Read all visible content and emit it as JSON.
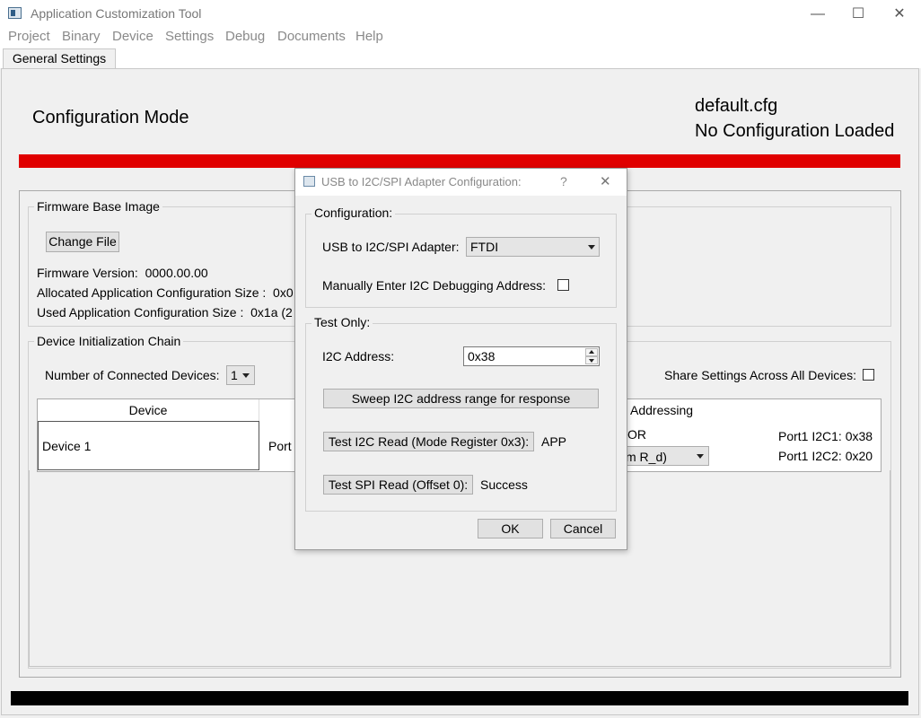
{
  "window": {
    "title": "Application Customization Tool",
    "minimize_glyph": "—",
    "maximize_glyph": "☐",
    "close_glyph": "✕"
  },
  "menu": [
    "Project",
    "Binary",
    "Device",
    "Settings",
    "Debug",
    "Documents",
    "Help"
  ],
  "tabs": [
    {
      "label": "General Settings"
    }
  ],
  "header": {
    "mode_title": "Configuration Mode",
    "config_file": "default.cfg",
    "config_status": "No Configuration Loaded"
  },
  "firmware": {
    "group_title": "Firmware Base Image",
    "change_file_label": "Change File",
    "version_line": "Firmware Version:  0000.00.00",
    "allocated_line": "Allocated Application Configuration Size :  0x0",
    "used_line": "Used Application Configuration Size :  0x1a (2"
  },
  "chain": {
    "group_title": "Device Initialization Chain",
    "num_devices_label": "Number of Connected Devices:",
    "num_devices_value": "1",
    "share_label": "Share Settings Across All Devices:",
    "table": {
      "col_device": "Device",
      "col_addressing": "Addressing",
      "rows": [
        {
          "device": "Device 1",
          "port_partial": "Port",
          "or_fragment": "OR",
          "select_fragment": "m R_d)",
          "port1_i2c1": "Port1 I2C1: 0x38",
          "port1_i2c2": "Port1 I2C2: 0x20"
        }
      ]
    }
  },
  "dialog": {
    "title": "USB to I2C/SPI Adapter Configuration:",
    "help_glyph": "?",
    "close_glyph": "✕",
    "config_group": "Configuration:",
    "adapter_label": "USB to I2C/SPI Adapter:",
    "adapter_value": "FTDI",
    "manual_label": "Manually Enter I2C Debugging Address:",
    "test_group": "Test Only:",
    "i2c_address_label": "I2C Address:",
    "i2c_address_value": "0x38",
    "sweep_label": "Sweep I2C address range for response",
    "test_i2c_label": "Test I2C Read (Mode Register 0x3):",
    "test_i2c_result": "APP",
    "test_spi_label": "Test SPI Read (Offset 0):",
    "test_spi_result": "Success",
    "ok_label": "OK",
    "cancel_label": "Cancel"
  }
}
